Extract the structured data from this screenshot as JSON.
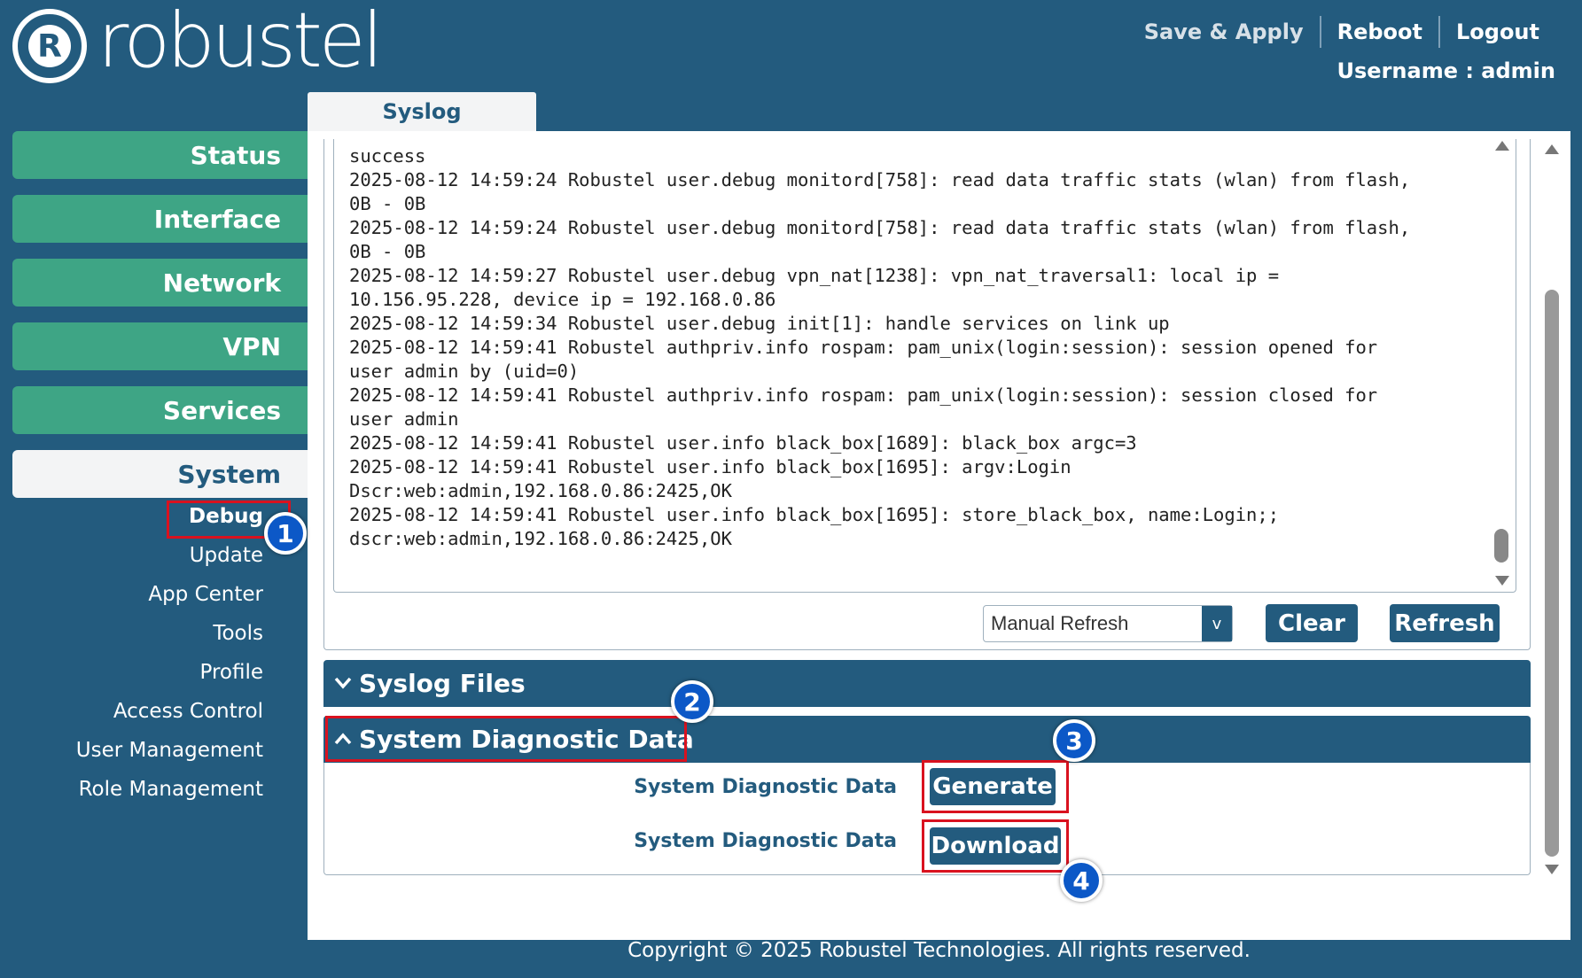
{
  "brand": {
    "logo_text": "robustel",
    "logo_mark": "R"
  },
  "header": {
    "save_apply": "Save & Apply",
    "reboot": "Reboot",
    "logout": "Logout",
    "username_label": "Username : admin"
  },
  "tab": {
    "label": "Syslog"
  },
  "sidebar": {
    "status": "Status",
    "interface": "Interface",
    "network": "Network",
    "vpn": "VPN",
    "services": "Services",
    "system": "System",
    "sub": {
      "debug": "Debug",
      "update": "Update",
      "app_center": "App Center",
      "tools": "Tools",
      "profile": "Profile",
      "access_control": "Access Control",
      "user_management": "User Management",
      "role_management": "Role Management"
    }
  },
  "log": {
    "text": "success\n2025-08-12 14:59:24 Robustel user.debug monitord[758]: read data traffic stats (wlan) from flash,\n0B - 0B\n2025-08-12 14:59:24 Robustel user.debug monitord[758]: read data traffic stats (wlan) from flash,\n0B - 0B\n2025-08-12 14:59:27 Robustel user.debug vpn_nat[1238]: vpn_nat_traversal1: local ip =\n10.156.95.228, device ip = 192.168.0.86\n2025-08-12 14:59:34 Robustel user.debug init[1]: handle services on link up\n2025-08-12 14:59:41 Robustel authpriv.info rospam: pam_unix(login:session): session opened for\nuser admin by (uid=0)\n2025-08-12 14:59:41 Robustel authpriv.info rospam: pam_unix(login:session): session closed for\nuser admin\n2025-08-12 14:59:41 Robustel user.info black_box[1689]: black_box argc=3\n2025-08-12 14:59:41 Robustel user.info black_box[1695]: argv:Login\nDscr:web:admin,192.168.0.86:2425,OK\n2025-08-12 14:59:41 Robustel user.info black_box[1695]: store_black_box, name:Login;;\ndscr:web:admin,192.168.0.86:2425,OK",
    "refresh_mode": "Manual Refresh",
    "select_arrow": "v",
    "clear": "Clear",
    "refresh": "Refresh"
  },
  "sections": {
    "syslog_files": "Syslog Files",
    "diag": "System Diagnostic Data",
    "diag_row1_label": "System Diagnostic Data",
    "diag_row2_label": "System Diagnostic Data",
    "generate": "Generate",
    "download": "Download"
  },
  "markers": [
    "1",
    "2",
    "3",
    "4"
  ],
  "footer": "Copyright © 2025 Robustel Technologies. All rights reserved.",
  "colors": {
    "header_bg": "#235b7e",
    "nav_green": "#3ea585",
    "highlight_red": "#d9121f",
    "marker_blue": "#0c58c7"
  }
}
